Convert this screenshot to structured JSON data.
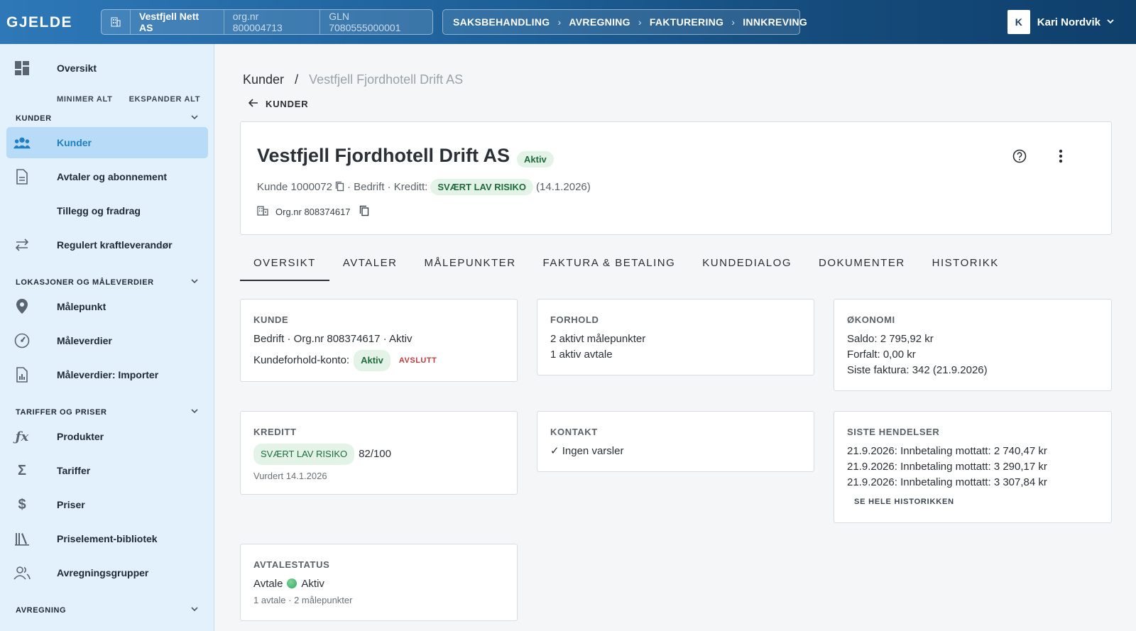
{
  "app": {
    "logo": "GJELDE"
  },
  "org": {
    "name": "Vestfjell Nett AS",
    "orgnr": "org.nr 800004713",
    "gln": "GLN 7080555000001"
  },
  "top_nav": {
    "items": [
      "SAKSBEHANDLING",
      "AVREGNING",
      "FAKTURERING",
      "INNKREVING"
    ],
    "separator": "›"
  },
  "user": {
    "initial": "K",
    "name": "Kari Nordvik"
  },
  "sidebar": {
    "overview": "Oversikt",
    "minimize_all": "MINIMER ALT",
    "expand_all": "EKSPANDER ALT",
    "sections": {
      "kunder": "KUNDER",
      "lokasjoner": "LOKASJONER OG MÅLEVERDIER",
      "tariffer": "TARIFFER OG PRISER",
      "avregning": "AVREGNING"
    },
    "items": {
      "kunder": "Kunder",
      "avtaler": "Avtaler og abonnement",
      "tillegg": "Tillegg og fradrag",
      "regulert": "Regulert kraftleverandør",
      "malepunkt": "Målepunkt",
      "maleverdier": "Måleverdier",
      "importer": "Måleverdier: Importer",
      "produkter": "Produkter",
      "tariffer": "Tariffer",
      "priser": "Priser",
      "priselement": "Priselement-bibliotek",
      "avregningsgrupper": "Avregningsgrupper"
    }
  },
  "breadcrumb": {
    "root": "Kunder",
    "sep": "/",
    "current": "Vestfjell Fjordhotell Drift AS"
  },
  "back_link": "KUNDER",
  "customer": {
    "name": "Vestfjell Fjordhotell Drift AS",
    "status": "Aktiv",
    "number": "Kunde 1000072",
    "type": "· Bedrift · Kreditt:",
    "risk": "SVÆRT LAV RISIKO",
    "risk_date": "(14.1.2026)",
    "orgnr": "Org.nr 808374617"
  },
  "tabs": [
    "OVERSIKT",
    "AVTALER",
    "MÅLEPUNKTER",
    "FAKTURA & BETALING",
    "KUNDEDIALOG",
    "DOKUMENTER",
    "HISTORIKK"
  ],
  "cards": {
    "kunde": {
      "title": "KUNDE",
      "line1": "Bedrift · Org.nr 808374617 · Aktiv",
      "account_label": "Kundeforhold-konto:",
      "account_status": "Aktiv",
      "end_link": "AVSLUTT"
    },
    "forhold": {
      "title": "FORHOLD",
      "line1": "2 aktivt målepunkter",
      "line2": "1 aktiv avtale"
    },
    "okonomi": {
      "title": "ØKONOMI",
      "line1": "Saldo: 2 795,92 kr",
      "line2": "Forfalt: 0,00 kr",
      "line3": "Siste faktura: 342 (21.9.2026)"
    },
    "kreditt": {
      "title": "KREDITT",
      "risk": "SVÆRT LAV RISIKO",
      "score": "82/100",
      "assessed": "Vurdert 14.1.2026"
    },
    "kontakt": {
      "title": "KONTAKT",
      "line1": "✓ Ingen varsler"
    },
    "hendelser": {
      "title": "SISTE HENDELSER",
      "events": [
        "21.9.2026: Innbetaling mottatt: 2 740,47 kr",
        "21.9.2026: Innbetaling mottatt: 3 290,17 kr",
        "21.9.2026: Innbetaling mottatt: 3 307,84 kr"
      ],
      "link": "SE HELE HISTORIKKEN"
    },
    "avtalestatus": {
      "title": "AVTALESTATUS",
      "label": "Avtale",
      "status": "Aktiv",
      "sub": "1 avtale · 2 målepunkter"
    }
  }
}
